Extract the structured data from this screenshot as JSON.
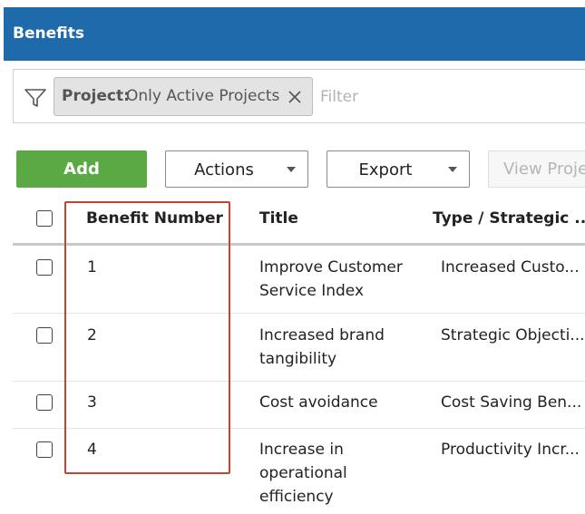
{
  "header": {
    "title": "Benefits"
  },
  "filter": {
    "chip_key": "Project:",
    "chip_value": "Only Active Projects",
    "input_placeholder": "Filter"
  },
  "toolbar": {
    "add_label": "Add",
    "actions_label": "Actions",
    "export_label": "Export",
    "view_label": "View Proje"
  },
  "table": {
    "columns": [
      "Benefit Number",
      "Title",
      "Type / Strategic ..."
    ],
    "rows": [
      {
        "number": "1",
        "title": "Improve Customer\nService Index",
        "type": "Increased Custo..."
      },
      {
        "number": "2",
        "title": "Increased brand\ntangibility",
        "type": "Strategic Objecti..."
      },
      {
        "number": "3",
        "title": "Cost avoidance",
        "type": "Cost Saving Ben..."
      },
      {
        "number": "4",
        "title": "Increase in\noperational\nefficiency",
        "type": "Productivity Incr..."
      }
    ]
  },
  "colors": {
    "header_bg": "#1f6aab",
    "add_button_bg": "#5aa945",
    "highlight_border": "#c4452f"
  }
}
